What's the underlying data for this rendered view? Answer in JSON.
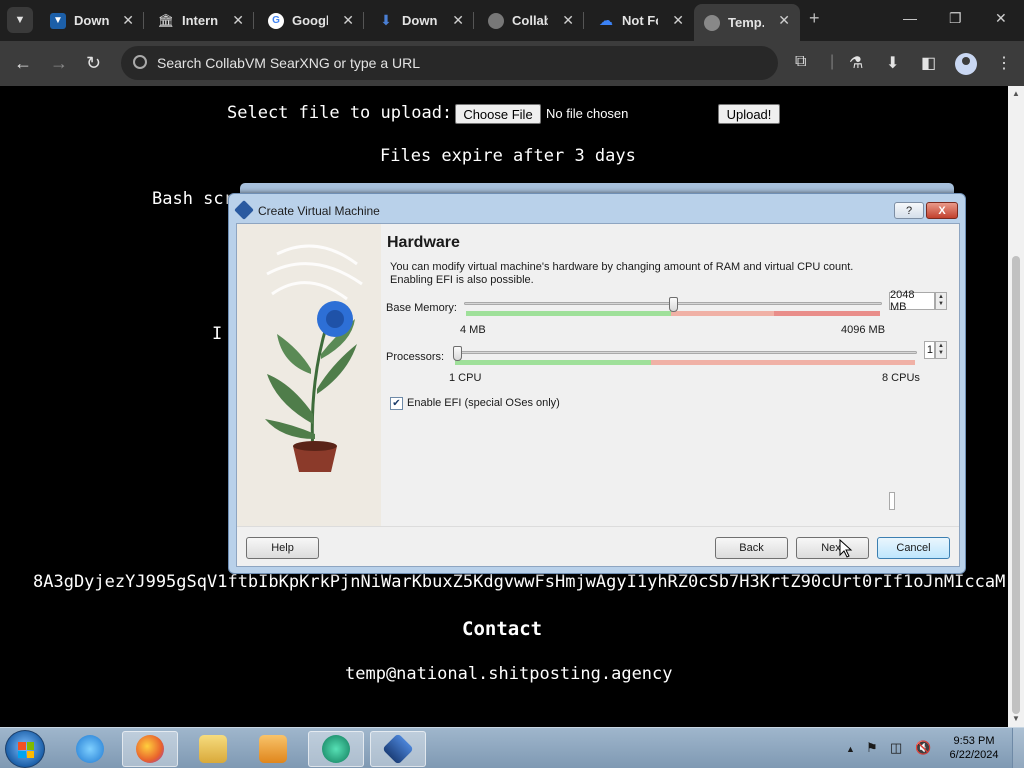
{
  "browser": {
    "tabs": [
      {
        "title": "Downl",
        "favicon": "vbox-download-icon",
        "color": "#1c5fa8"
      },
      {
        "title": "Interne",
        "favicon": "archive-icon",
        "color": "#555555"
      },
      {
        "title": "Googl",
        "favicon": "google-icon",
        "color": "#ffffff"
      },
      {
        "title": "Downl",
        "favicon": "download-arrow-icon",
        "color": "#4a7fd4"
      },
      {
        "title": "Collab",
        "favicon": "collabvm-icon",
        "color": "#777777"
      },
      {
        "title": "Not Fo",
        "favicon": "cloud-icon",
        "color": "#3b82f6"
      },
      {
        "title": "Temp.s",
        "favicon": "globe-icon",
        "color": "#888888"
      }
    ],
    "new_tab": "+",
    "omnibox_text": "Search CollabVM SearXNG or type a URL"
  },
  "page": {
    "upload_label": "Select file to upload:",
    "choose_file": "Choose File",
    "no_file": "No file chosen",
    "upload_button": "Upload!",
    "expire_text": "Files expire after 3 days",
    "bash_text": "Bash scr",
    "i_char": "I",
    "hash_text": "8A3gDyjezYJ995gSqV1ftbIbKpKrkPjnNiWarKbuxZ5KdgvwwFsHmjwAgyI1yhRZ0cSb7H3KrtZ90cUrt0rIf1oJnMIccaM",
    "contact_heading": "Contact",
    "email": "temp@national.shitposting.agency"
  },
  "dialog": {
    "title": "Create Virtual Machine",
    "help_glyph": "?",
    "close_glyph": "X",
    "heading": "Hardware",
    "description_line1": "You can modify virtual machine's hardware by changing amount of RAM and virtual CPU count.",
    "description_line2": "Enabling EFI is also possible.",
    "memory": {
      "label": "Base Memory:",
      "value": 2048,
      "display": "2048 MB",
      "min": 4,
      "max": 4096,
      "min_label": "4 MB",
      "max_label": "4096 MB"
    },
    "processors": {
      "label": "Processors:",
      "value": 1,
      "display": "1",
      "min": 1,
      "max": 8,
      "min_label": "1 CPU",
      "max_label": "8 CPUs"
    },
    "efi": {
      "label": "Enable EFI (special OSes only)",
      "checked": true
    },
    "buttons": {
      "help": "Help",
      "back": "Back",
      "next": "Next",
      "cancel": "Cancel"
    }
  },
  "taskbar": {
    "apps": [
      {
        "name": "internet-explorer",
        "color": "#2f8fe0"
      },
      {
        "name": "firefox",
        "color": "#e8622c"
      },
      {
        "name": "file-explorer",
        "color": "#e9c85a"
      },
      {
        "name": "media-player",
        "color": "#e89a2c"
      },
      {
        "name": "remote-app",
        "color": "#1aa37a"
      },
      {
        "name": "virtualbox",
        "color": "#2a5aa0"
      }
    ],
    "clock_time": "9:53 PM",
    "clock_date": "6/22/2024"
  }
}
